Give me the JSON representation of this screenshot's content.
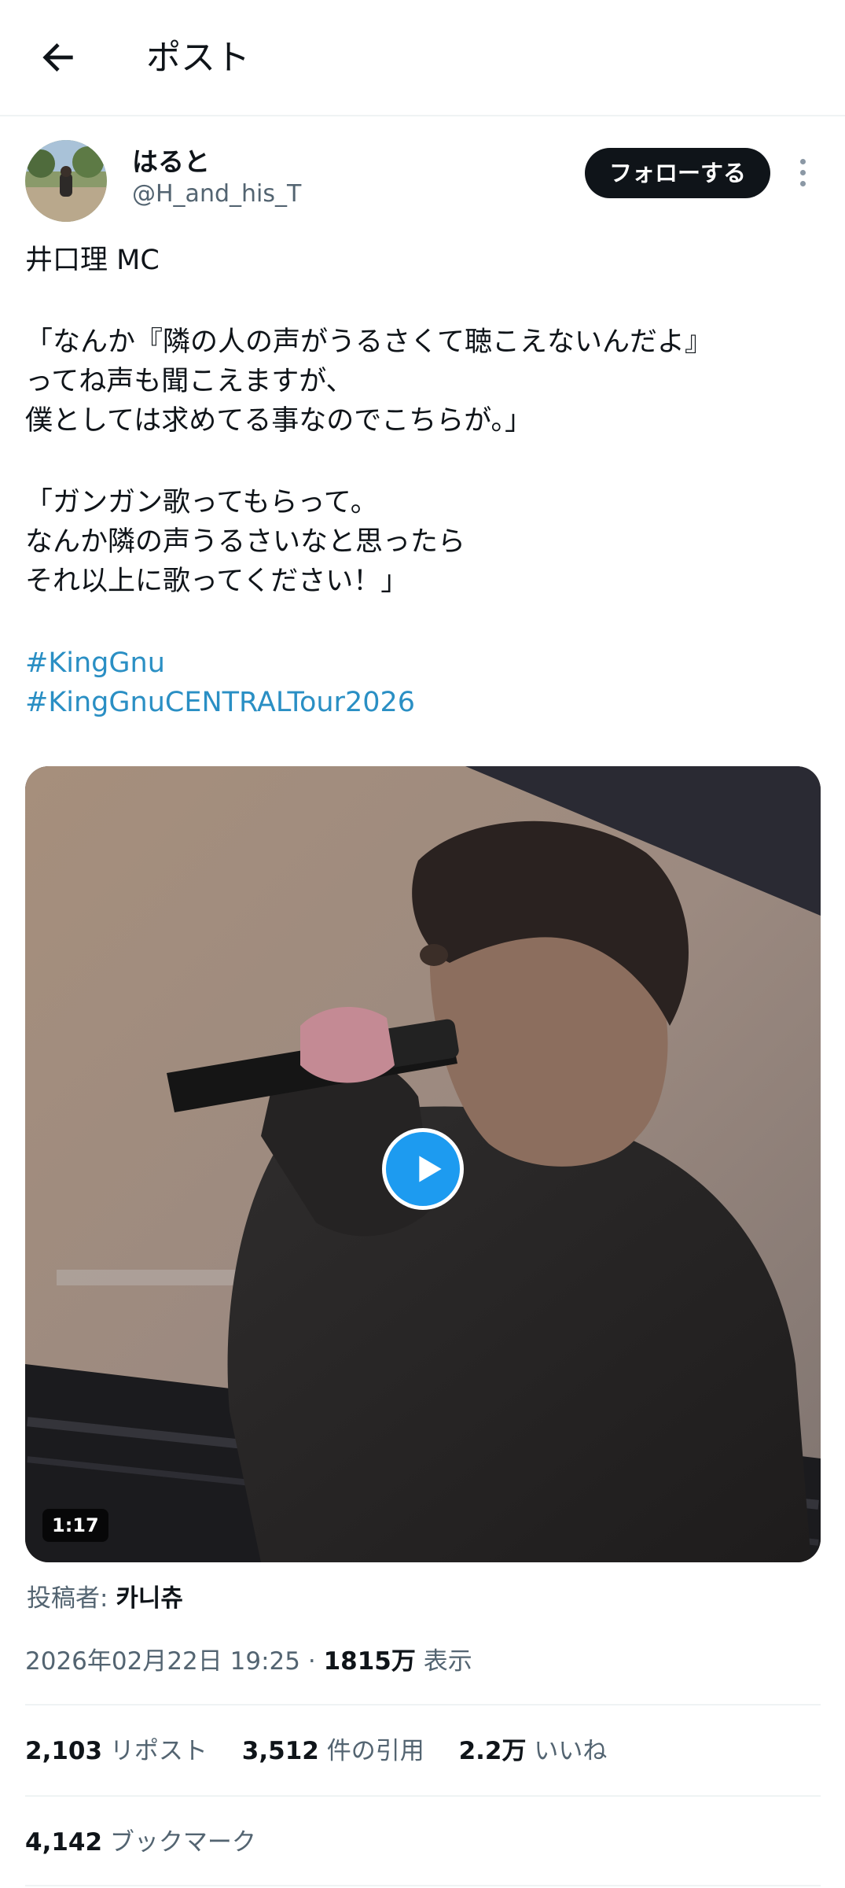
{
  "header": {
    "back_icon": "arrow-left-icon",
    "title": "ポスト"
  },
  "author": {
    "display_name": "はると",
    "handle": "@H_and_his_T",
    "follow_label": "フォローする",
    "more_icon": "more-vertical-icon"
  },
  "post": {
    "lines": [
      "井口理 MC",
      "",
      "「なんか『隣の人の声がうるさくて聴こえないんだよ』",
      "ってね声も聞こえますが、",
      "僕としては求めてる事なのでこちらが。」",
      "",
      "「ガンガン歌ってもらって。",
      "なんか隣の声うるさいなと思ったら",
      "それ以上に歌ってください！」",
      ""
    ],
    "hashtags": [
      "#KingGnu",
      "#KingGnuCENTRALTour2026"
    ]
  },
  "media": {
    "duration": "1:17",
    "play_icon": "play-icon"
  },
  "poster": {
    "label": "投稿者:",
    "name": "카니츄"
  },
  "meta": {
    "timestamp": "2026年02月22日 19:25",
    "separator": "·",
    "views_count": "1815万",
    "views_label": "表示"
  },
  "stats": {
    "reposts_count": "2,103",
    "reposts_label": "リポスト",
    "quotes_count": "3,512",
    "quotes_label": "件の引用",
    "likes_count": "2.2万",
    "likes_label": "いいね",
    "bookmarks_count": "4,142",
    "bookmarks_label": "ブックマーク"
  },
  "colors": {
    "accent": "#1d9bf0",
    "hashtag": "#2a8fc4",
    "text": "#0f1419",
    "secondary": "#536471",
    "follow_bg": "#0f1419"
  }
}
